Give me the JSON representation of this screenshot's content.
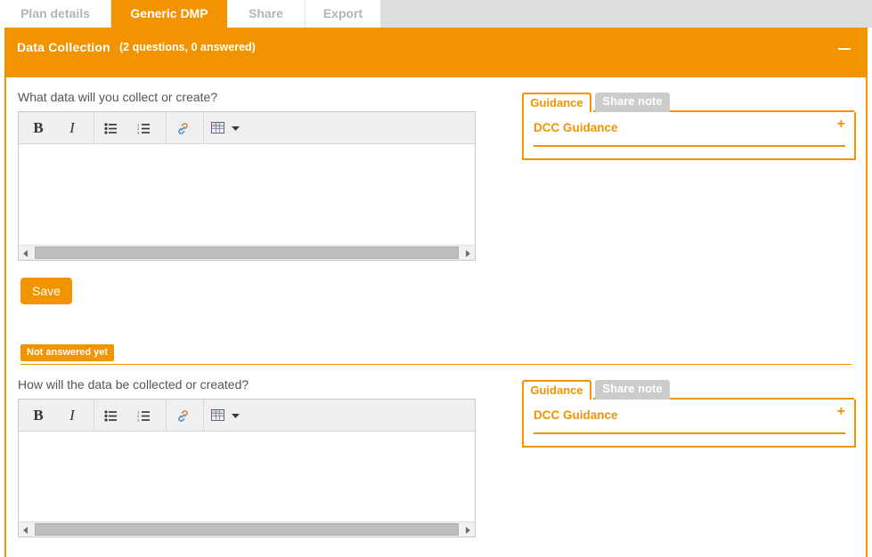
{
  "tabs": [
    {
      "label": "Plan details",
      "active": false
    },
    {
      "label": "Generic DMP",
      "active": true
    },
    {
      "label": "Share",
      "active": false
    },
    {
      "label": "Export",
      "active": false
    }
  ],
  "section": {
    "title": "Data Collection",
    "count_label": "(2 questions, 0 answered)",
    "collapse_icon": "minus-icon"
  },
  "toolbar": {
    "bold_label": "B",
    "italic_label": "I",
    "bold_icon": "bold-icon",
    "italic_icon": "italic-icon",
    "bullet_list_icon": "unordered-list-icon",
    "numbered_list_icon": "ordered-list-icon",
    "link_icon": "link-icon",
    "table_icon": "table-icon",
    "table_caret_icon": "chevron-down-icon"
  },
  "scrollbar": {
    "left_arrow_icon": "arrow-left-icon",
    "right_arrow_icon": "arrow-right-icon"
  },
  "questions": [
    {
      "text": "What data will you collect or create?",
      "answer_value": "",
      "answer_placeholder": "",
      "save_label": "Save",
      "status_label": "Not answered yet",
      "guidance": {
        "tab_guidance": "Guidance",
        "tab_share_note": "Share note",
        "item_label": "DCC Guidance",
        "expand_label": "+"
      }
    },
    {
      "text": "How will the data be collected or created?",
      "answer_value": "",
      "answer_placeholder": "",
      "guidance": {
        "tab_guidance": "Guidance",
        "tab_share_note": "Share note",
        "item_label": "DCC Guidance",
        "expand_label": "+"
      }
    }
  ],
  "colors": {
    "accent": "#f29400",
    "tab_inactive_text": "#b5b5b5",
    "tab_strip_bg": "#dddddd",
    "toolbar_bg": "#f0f0f0",
    "scroll_thumb": "#bdbdbd",
    "guidance_inactive_tab": "#cccccc"
  }
}
